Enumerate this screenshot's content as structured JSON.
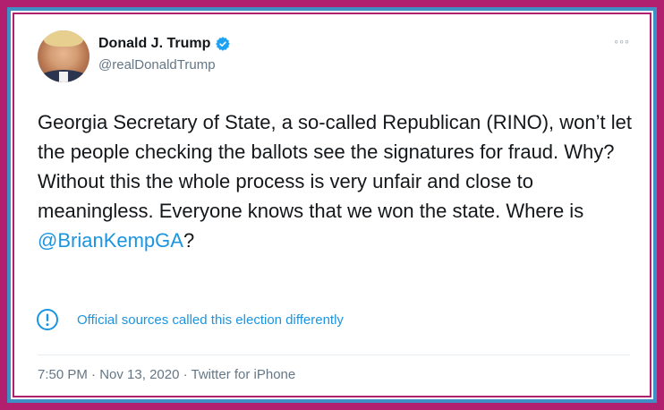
{
  "user": {
    "display_name": "Donald J. Trump",
    "handle": "@realDonaldTrump",
    "verified_icon": "verified-badge-icon"
  },
  "menu": {
    "more_icon": "more-options-icon",
    "more_glyph": "◦◦◦"
  },
  "tweet": {
    "text_before_mention": "Georgia Secretary of State, a so-called Republican (RINO), won’t let the people checking the ballots see the signatures for fraud. Why? Without this the whole process is very unfair and close to meaningless. Everyone knows that we won the state. Where is ",
    "mention": "@BrianKempGA",
    "text_after_mention": "?"
  },
  "notice": {
    "icon": "exclamation-circle-icon",
    "text": "Official sources called this election differently"
  },
  "footer": {
    "time": "7:50 PM",
    "sep1": " · ",
    "date": "Nov 13, 2020",
    "sep2": " · ",
    "source": "Twitter for iPhone"
  },
  "colors": {
    "frame": "#b0206e",
    "border_blue": "#3f8fc7",
    "link_blue": "#1b95e0",
    "text": "#14171a",
    "muted": "#657786"
  }
}
